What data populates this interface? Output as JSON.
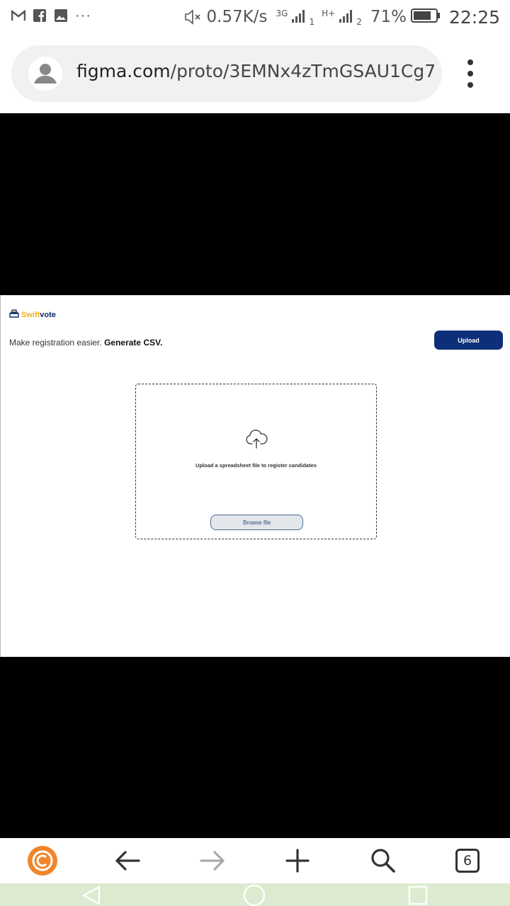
{
  "status_bar": {
    "notification_icons": [
      "gmail-icon",
      "facebook-icon",
      "gallery-icon"
    ],
    "more_dots": "···",
    "net_speed": "0.57K/s",
    "network_1": "3G",
    "sim_1": "1",
    "network_2": "H+",
    "sim_2": "2",
    "battery": "71%",
    "time": "22:25"
  },
  "url_bar": {
    "host": "figma.com",
    "path": "/proto/3EMNx4zTmGSAU1Cg7"
  },
  "app": {
    "brand_part1": "Swift",
    "brand_part2": "vote",
    "tagline_text": "Make registration easier.",
    "tagline_bold": "Generate CSV.",
    "upload_label": "Upload",
    "dropzone_message": "Upload a spreadsheet file to register candidates",
    "browse_label": "Browse file"
  },
  "toolbar": {
    "tab_count": "6"
  },
  "colors": {
    "brand_navy": "#0d2f7a",
    "brand_yellow": "#f5b21e",
    "toolbar_orange": "#f0852a",
    "navbar_bg": "#dcebd0"
  }
}
